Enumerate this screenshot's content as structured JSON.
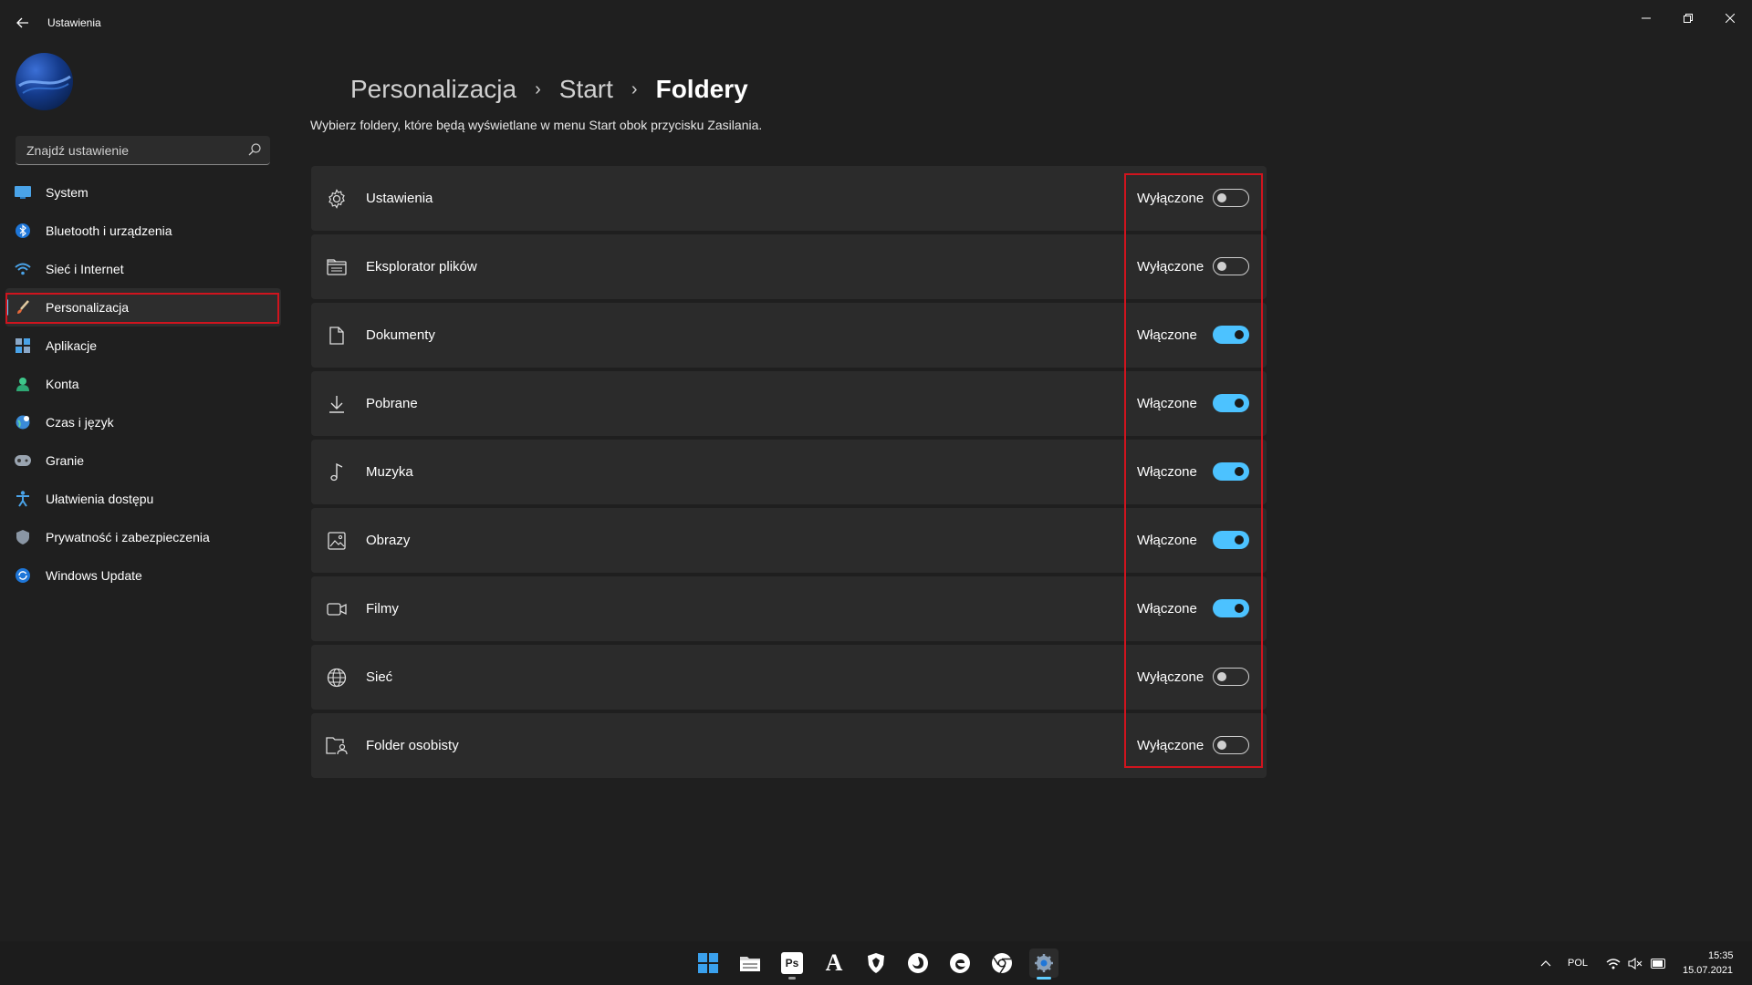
{
  "window": {
    "title": "Ustawienia",
    "back_icon": "arrow-left-icon"
  },
  "search": {
    "placeholder": "Znajdź ustawienie"
  },
  "sidebar": {
    "items": [
      {
        "label": "System",
        "icon": "monitor-icon",
        "active": false
      },
      {
        "label": "Bluetooth i urządzenia",
        "icon": "bluetooth-icon",
        "active": false
      },
      {
        "label": "Sieć i Internet",
        "icon": "wifi-icon",
        "active": false
      },
      {
        "label": "Personalizacja",
        "icon": "paintbrush-icon",
        "active": true
      },
      {
        "label": "Aplikacje",
        "icon": "apps-icon",
        "active": false
      },
      {
        "label": "Konta",
        "icon": "person-icon",
        "active": false
      },
      {
        "label": "Czas i język",
        "icon": "globe-clock-icon",
        "active": false
      },
      {
        "label": "Granie",
        "icon": "gamepad-icon",
        "active": false
      },
      {
        "label": "Ułatwienia dostępu",
        "icon": "accessibility-icon",
        "active": false
      },
      {
        "label": "Prywatność i zabezpieczenia",
        "icon": "shield-icon",
        "active": false
      },
      {
        "label": "Windows Update",
        "icon": "update-icon",
        "active": false
      }
    ]
  },
  "header": {
    "breadcrumb": [
      "Personalizacja",
      "Start",
      "Foldery"
    ],
    "subtitle": "Wybierz foldery, które będą wyświetlane w menu Start obok przycisku Zasilania."
  },
  "folders": [
    {
      "label": "Ustawienia",
      "icon": "gear-icon",
      "state": "Wyłączone",
      "on": false
    },
    {
      "label": "Eksplorator plików",
      "icon": "file-explorer-icon",
      "state": "Wyłączone",
      "on": false
    },
    {
      "label": "Dokumenty",
      "icon": "document-icon",
      "state": "Włączone",
      "on": true
    },
    {
      "label": "Pobrane",
      "icon": "download-icon",
      "state": "Włączone",
      "on": true
    },
    {
      "label": "Muzyka",
      "icon": "music-note-icon",
      "state": "Włączone",
      "on": true
    },
    {
      "label": "Obrazy",
      "icon": "image-icon",
      "state": "Włączone",
      "on": true
    },
    {
      "label": "Filmy",
      "icon": "video-icon",
      "state": "Włączone",
      "on": true
    },
    {
      "label": "Sieć",
      "icon": "network-globe-icon",
      "state": "Wyłączone",
      "on": false
    },
    {
      "label": "Folder osobisty",
      "icon": "personal-folder-icon",
      "state": "Wyłączone",
      "on": false
    }
  ],
  "taskbar": {
    "apps": [
      {
        "icon": "windows-start-icon"
      },
      {
        "icon": "file-explorer-icon"
      },
      {
        "icon": "photoshop-icon",
        "text": "Ps"
      },
      {
        "icon": "font-a-icon",
        "text": "A"
      },
      {
        "icon": "brave-icon"
      },
      {
        "icon": "firefox-icon"
      },
      {
        "icon": "edge-icon"
      },
      {
        "icon": "chrome-icon"
      },
      {
        "icon": "settings-icon"
      }
    ],
    "tray": {
      "language": "POL",
      "time": "15:35",
      "date": "15.07.2021"
    }
  },
  "colors": {
    "accent": "#4cc2ff",
    "highlight": "#d0141e",
    "background": "#1f1f1f",
    "card": "#2b2b2b"
  }
}
